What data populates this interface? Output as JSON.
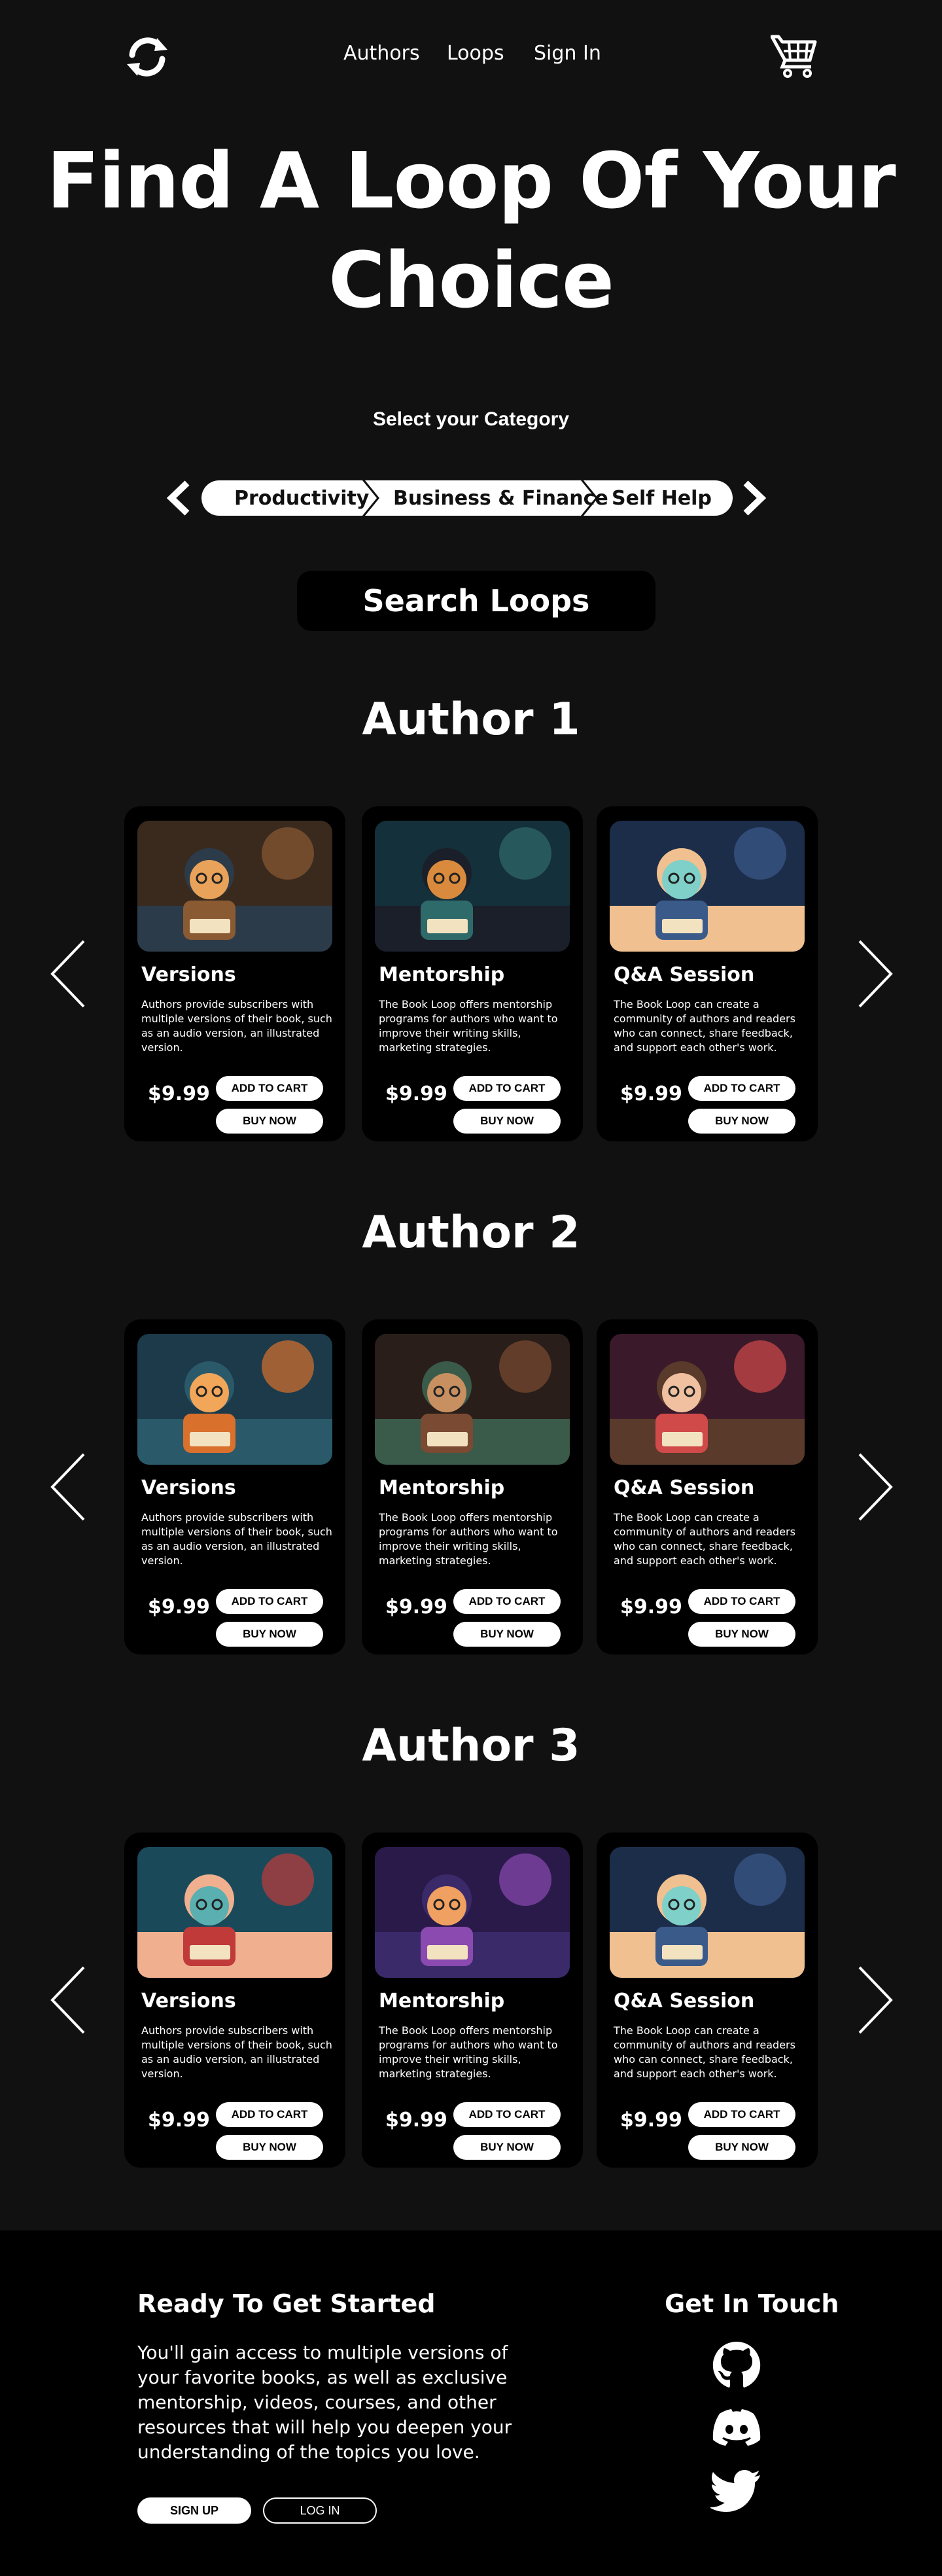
{
  "header": {
    "nav": [
      "Authors",
      "Loops",
      "Sign In"
    ]
  },
  "hero": {
    "title_line1": "Find A Loop Of Your",
    "title_line2": "Choice"
  },
  "categories": {
    "label": "Select your Category",
    "items": [
      "Productivity",
      "Business & Finance",
      "Self Help"
    ]
  },
  "search": {
    "label": "Search Loops"
  },
  "authors": [
    {
      "name": "Author 1",
      "cards": [
        {
          "title": "Versions",
          "desc": "Authors provide subscribers with multiple versions of their book, such as an audio version, an illustrated version.",
          "price": "$9.99",
          "add": "ADD TO CART",
          "buy": "BUY NOW"
        },
        {
          "title": "Mentorship",
          "desc": "The Book Loop offers mentorship programs for authors who want to improve their writing skills, marketing strategies.",
          "price": "$9.99",
          "add": "ADD TO CART",
          "buy": "BUY NOW"
        },
        {
          "title": "Q&A Session",
          "desc": "The Book Loop can create a community of authors and readers who can connect, share feedback, and support each other's work.",
          "price": "$9.99",
          "add": "ADD TO CART",
          "buy": "BUY NOW"
        }
      ]
    },
    {
      "name": "Author 2",
      "cards": [
        {
          "title": "Versions",
          "desc": "Authors provide subscribers with multiple versions of their book, such as an audio version, an illustrated version.",
          "price": "$9.99",
          "add": "ADD TO CART",
          "buy": "BUY NOW"
        },
        {
          "title": "Mentorship",
          "desc": "The Book Loop offers mentorship programs for authors who want to improve their writing skills, marketing strategies.",
          "price": "$9.99",
          "add": "ADD TO CART",
          "buy": "BUY NOW"
        },
        {
          "title": "Q&A Session",
          "desc": "The Book Loop can create a community of authors and readers who can connect, share feedback, and support each other's work.",
          "price": "$9.99",
          "add": "ADD TO CART",
          "buy": "BUY NOW"
        }
      ]
    },
    {
      "name": "Author 3",
      "cards": [
        {
          "title": "Versions",
          "desc": "Authors provide subscribers with multiple versions of their book, such as an audio version, an illustrated version.",
          "price": "$9.99",
          "add": "ADD TO CART",
          "buy": "BUY NOW"
        },
        {
          "title": "Mentorship",
          "desc": "The Book Loop offers mentorship programs for authors who want to improve their writing skills, marketing strategies.",
          "price": "$9.99",
          "add": "ADD TO CART",
          "buy": "BUY NOW"
        },
        {
          "title": "Q&A Session",
          "desc": "The Book Loop can create a community of authors and readers who can connect, share feedback, and support each other's work.",
          "price": "$9.99",
          "add": "ADD TO CART",
          "buy": "BUY NOW"
        }
      ]
    }
  ],
  "footer": {
    "title": "Ready To Get Started",
    "text": "You'll gain access to multiple versions of your favorite books, as well as exclusive mentorship, videos, courses, and other resources that will help you deepen your understanding of the topics you love.",
    "signup": "SIGN UP",
    "login": "LOG IN",
    "touch_title": "Get In Touch",
    "socials": [
      "github-icon",
      "discord-icon",
      "twitter-icon"
    ]
  },
  "colors": {
    "background": "#111111",
    "card": "#000000",
    "accent": "#ffffff"
  }
}
